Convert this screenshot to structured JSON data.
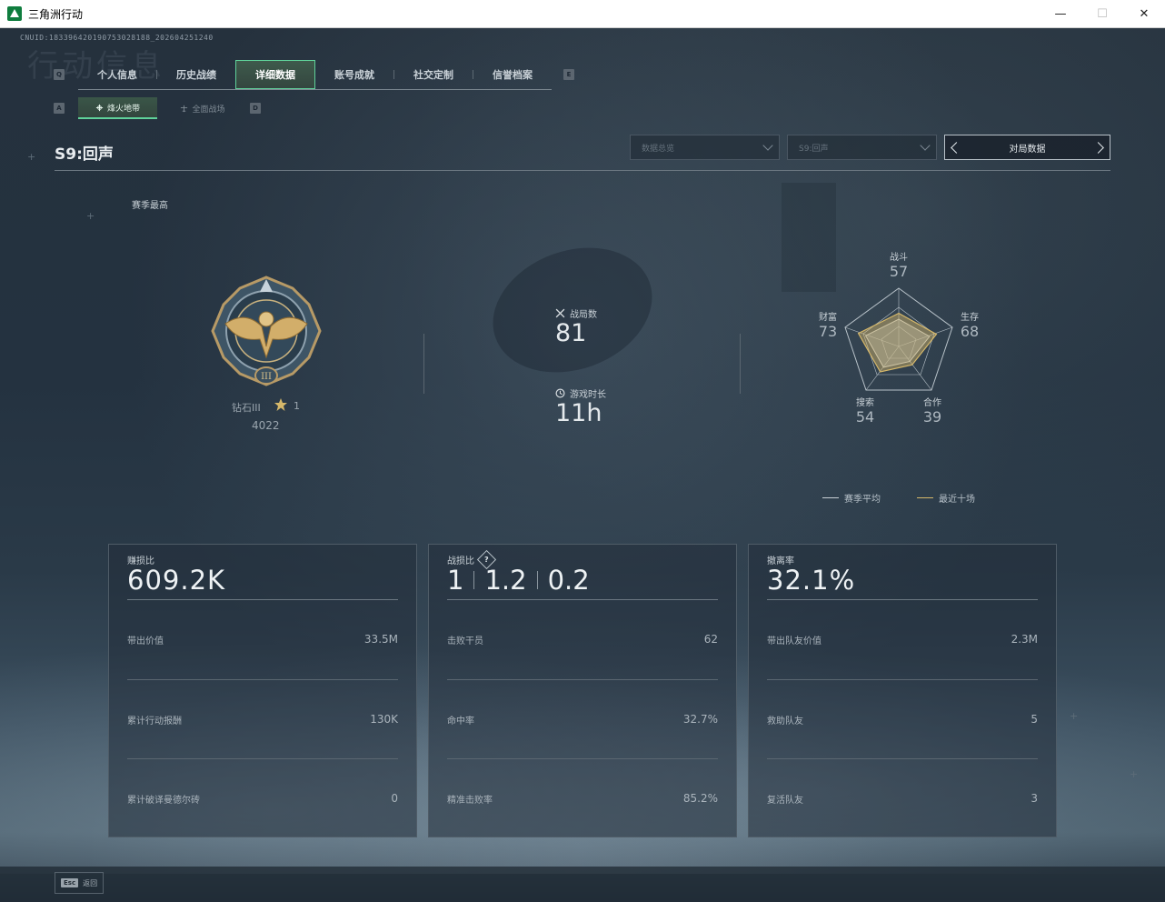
{
  "window": {
    "title": "三角洲行动",
    "minimize": "—",
    "maximize": "☐",
    "close": "✕"
  },
  "header": {
    "cnuid": "CNUID:1833964201907530281​88_202604251240",
    "ghost_title": "行动信息",
    "key_left": "Q",
    "key_right": "E",
    "tabs": [
      "个人信息",
      "历史战绩",
      "详细数据",
      "账号成就",
      "社交定制",
      "信誉档案"
    ],
    "active_tab": 2,
    "sub_key_left": "A",
    "sub_key_right": "D",
    "subtabs": [
      "烽火地带",
      "全面战场"
    ],
    "active_subtab": 0
  },
  "season": {
    "title": "S9:回声",
    "dropdown_mode": "数据总览",
    "dropdown_season": "S9:回声",
    "match_switch": "对局数据"
  },
  "rank": {
    "peak_label": "赛季最高",
    "tier": "钻石III",
    "stars": "1",
    "score": "4022"
  },
  "summary": {
    "matches_label": "战局数",
    "matches_value": "81",
    "playtime_label": "游戏时长",
    "playtime_value": "11h"
  },
  "radar": {
    "labels": [
      "战斗",
      "生存",
      "合作",
      "搜索",
      "财富"
    ],
    "values": [
      "57",
      "68",
      "39",
      "54",
      "73"
    ],
    "legend_avg": "赛季平均",
    "legend_recent": "最近十场",
    "avg_color": "#c8d0d6",
    "recent_color": "#d6b86a"
  },
  "cards": {
    "profit": {
      "title": "赚损比",
      "value": "609.2K",
      "rows": [
        {
          "label": "带出价值",
          "value": "33.5M"
        },
        {
          "label": "累计行动报酬",
          "value": "130K"
        },
        {
          "label": "累计破译曼德尔砖",
          "value": "0"
        }
      ]
    },
    "combat": {
      "title": "战损比",
      "help": "?",
      "values": [
        "1",
        "1.2",
        "0.2"
      ],
      "rows": [
        {
          "label": "击败干员",
          "value": "62"
        },
        {
          "label": "命中率",
          "value": "32.7%"
        },
        {
          "label": "精准击败率",
          "value": "85.2%"
        }
      ]
    },
    "extract": {
      "title": "撤离率",
      "value": "32.1%",
      "rows": [
        {
          "label": "带出队友价值",
          "value": "2.3M"
        },
        {
          "label": "救助队友",
          "value": "5"
        },
        {
          "label": "复活队友",
          "value": "3"
        }
      ]
    }
  },
  "footer": {
    "esc_key": "Esc",
    "esc_label": "返回"
  }
}
